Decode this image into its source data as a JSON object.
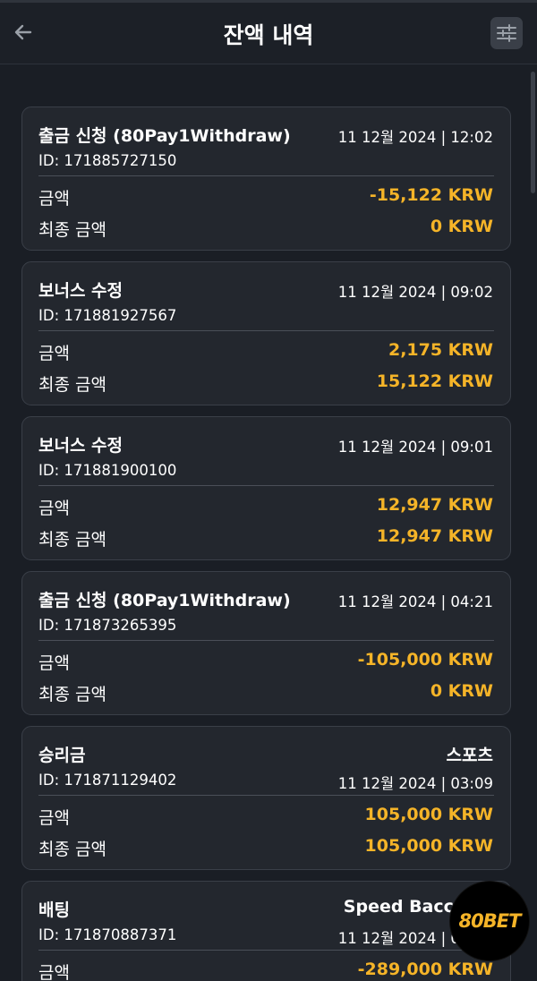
{
  "header": {
    "title": "잔액 내역"
  },
  "transactions": [
    {
      "type": "출금 신청 (80Pay1Withdraw)",
      "datetime": "11 12월 2024 | 12:02",
      "id": "ID: 171885727150",
      "amount_label": "금액",
      "amount": "-15,122 KRW",
      "final_label": "최종 금액",
      "final": "0 KRW"
    },
    {
      "type": "보너스 수정",
      "datetime": "11 12월 2024 | 09:02",
      "id": "ID: 171881927567",
      "amount_label": "금액",
      "amount": "2,175 KRW",
      "final_label": "최종 금액",
      "final": "15,122 KRW"
    },
    {
      "type": "보너스 수정",
      "datetime": "11 12월 2024 | 09:01",
      "id": "ID: 171881900100",
      "amount_label": "금액",
      "amount": "12,947 KRW",
      "final_label": "최종 금액",
      "final": "12,947 KRW"
    },
    {
      "type": "출금 신청 (80Pay1Withdraw)",
      "datetime": "11 12월 2024 | 04:21",
      "id": "ID: 171873265395",
      "amount_label": "금액",
      "amount": "-105,000 KRW",
      "final_label": "최종 금액",
      "final": "0 KRW"
    },
    {
      "type": "승리금",
      "category": "스포츠",
      "id": "ID: 171871129402",
      "datetime": "11 12월 2024 | 03:09",
      "amount_label": "금액",
      "amount": "105,000 KRW",
      "final_label": "최종 금액",
      "final": "105,000 KRW"
    },
    {
      "type": "배팅",
      "category": "Speed Baccarat",
      "id": "ID: 171870887371",
      "datetime": "11 12월 2024 | 02:58",
      "amount_label": "금액",
      "amount": "-289,000 KRW"
    }
  ],
  "badge": {
    "text": "80BET"
  },
  "colors": {
    "background": "#1a1e25",
    "card": "#23272e",
    "accent": "#f5b428"
  },
  "icons": {
    "back": "arrow-left-icon",
    "filter": "sliders-icon"
  }
}
